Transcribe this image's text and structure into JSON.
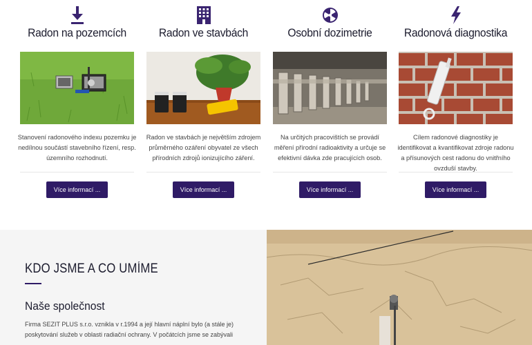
{
  "services": [
    {
      "icon": "download-arrow-icon",
      "title": "Radon na pozemcích",
      "description": "Stanovení radonového indexu pozemku je nedílnou součástí stavebního řízení, resp. územního rozhodnutí.",
      "button": "Více informací ..."
    },
    {
      "icon": "building-icon",
      "title": "Radon ve stavbách",
      "description": "Radon ve stavbách je největším zdrojem průměrného ozáření obyvatel ze všech přírodních zdrojů ionizujícího záření.",
      "button": "Více informací ..."
    },
    {
      "icon": "radiation-icon",
      "title": "Osobní dozimetrie",
      "description": "Na určitých pracovištích se provádí měření přírodní radioaktivity a určuje se efektivní dávka zde pracujících osob.",
      "button": "Více informací ..."
    },
    {
      "icon": "lightning-icon",
      "title": "Radonová diagnostika",
      "description": "Cílem radonové diagnostiky je identifikovat a kvantifikovat zdroje radonu a přísunových cest radonu do vnitřního ovzduší stavby.",
      "button": "Více informací ..."
    }
  ],
  "about": {
    "heading": "KDO JSME A CO UMÍME",
    "subheading": "Naše společnost",
    "body": "Firma SEZIT PLUS s.r.o. vznikla v r.1994 a její hlavní náplní bylo (a stále je) poskytování služeb v oblasti radiační ochrany. V počátcích jsme se zabývali"
  },
  "colors": {
    "accent": "#2f1b66",
    "icon": "#3a2470"
  }
}
